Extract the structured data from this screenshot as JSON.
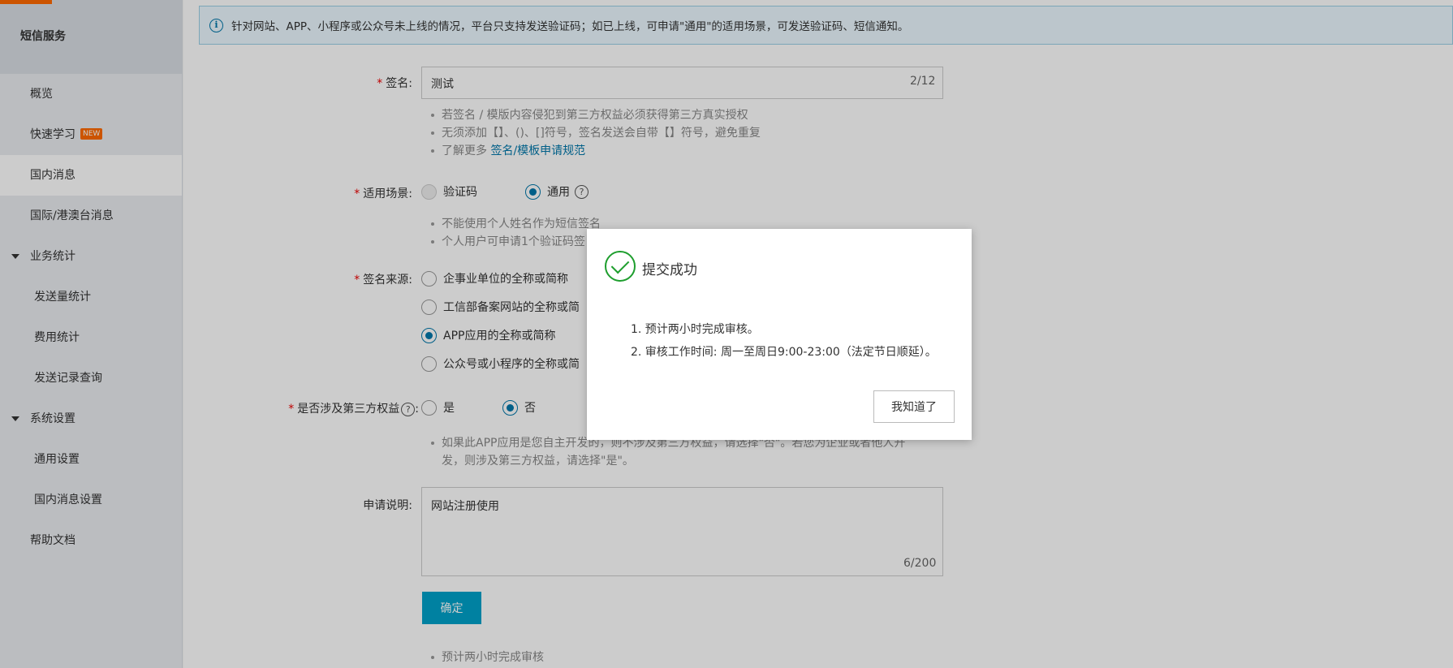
{
  "sidebar": {
    "title": "短信服务",
    "items": [
      {
        "label": "概览",
        "name": "sidebar-item-overview"
      },
      {
        "label": "快速学习",
        "name": "sidebar-item-quick-learn",
        "badge": "NEW"
      },
      {
        "label": "国内消息",
        "name": "sidebar-item-domestic",
        "active": true
      },
      {
        "label": "国际/港澳台消息",
        "name": "sidebar-item-international"
      },
      {
        "label": "业务统计",
        "name": "sidebar-group-stats"
      },
      {
        "label": "发送量统计",
        "name": "sidebar-item-send-stats"
      },
      {
        "label": "费用统计",
        "name": "sidebar-item-cost-stats"
      },
      {
        "label": "发送记录查询",
        "name": "sidebar-item-send-records"
      },
      {
        "label": "系统设置",
        "name": "sidebar-group-settings"
      },
      {
        "label": "通用设置",
        "name": "sidebar-item-general-settings"
      },
      {
        "label": "国内消息设置",
        "name": "sidebar-item-domestic-settings"
      },
      {
        "label": "帮助文档",
        "name": "sidebar-item-help"
      }
    ]
  },
  "notice": {
    "text": "针对网站、APP、小程序或公众号未上线的情况，平台只支持发送验证码；如已上线，可申请\"通用\"的适用场景，可发送验证码、短信通知。"
  },
  "form": {
    "required_mark": "*",
    "signature": {
      "label": "签名:",
      "value": "测试",
      "counter": "2/12",
      "hints": [
        "若签名 / 模版内容侵犯到第三方权益必须获得第三方真实授权",
        "无须添加【】、()、[]符号，签名发送会自带【】符号，避免重复"
      ],
      "more_prefix": "了解更多 ",
      "more_link": "签名/模板申请规范"
    },
    "scene": {
      "label": "适用场景:",
      "options": [
        "验证码",
        "通用"
      ],
      "hints": [
        "不能使用个人姓名作为短信签名",
        "个人用户可申请1个验证码签"
      ]
    },
    "source": {
      "label": "签名来源:",
      "options": [
        "企事业单位的全称或简称",
        "工信部备案网站的全称或简",
        "APP应用的全称或简称",
        "公众号或小程序的全称或简"
      ]
    },
    "third_party": {
      "label": "是否涉及第三方权益",
      "label_suffix": ":",
      "options": [
        "是",
        "否"
      ],
      "hint_line1": "如果此APP应用是您自主开发的，则不涉及第三方权益，请选择\"否\"。若您为企业或者他人开",
      "hint_line2": "发，则涉及第三方权益，请选择\"是\"。"
    },
    "description": {
      "label": "申请说明:",
      "value": "网站注册使用",
      "counter": "6/200"
    },
    "submit_label": "确定",
    "footer_hint": "预计两小时完成审核"
  },
  "dialog": {
    "title": "提交成功",
    "lines": [
      "1. 预计两小时完成审核。",
      "2. 审核工作时间: 周一至周日9:00-23:00（法定节日顺延）。"
    ],
    "ok_label": "我知道了"
  },
  "colors": {
    "accent": "#ff6a00",
    "primary": "#00a2ca",
    "link": "#0077aa",
    "success": "#1e9e2e",
    "required": "#e00000"
  }
}
